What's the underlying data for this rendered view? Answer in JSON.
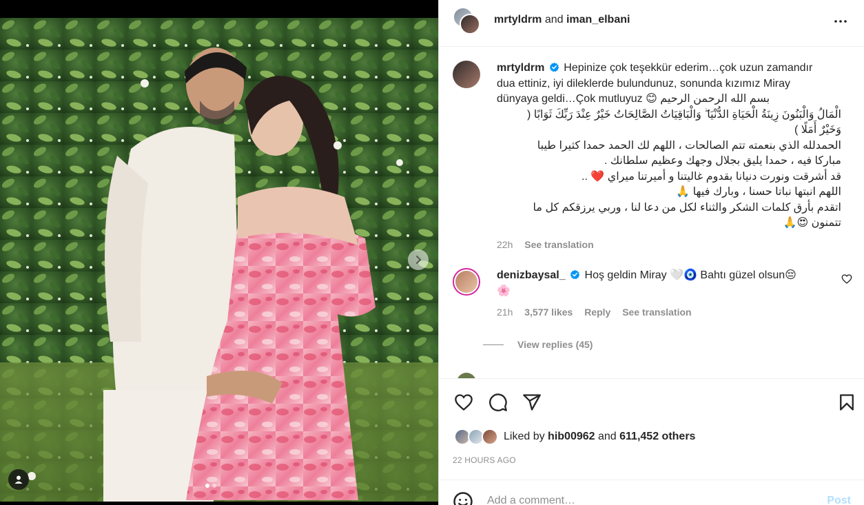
{
  "post": {
    "header": {
      "author": "mrtyldrm",
      "and": "and",
      "coauthor": "iman_elbani"
    },
    "caption": {
      "username": "mrtyldrm",
      "text_lines": [
        "Hepinize çok teşekkür ederim…çok uzun zamandır",
        "dua ettiniz, iyi dileklerde bulundunuz, sonunda kızımız Miray",
        "dünyaya geldi…Çok mutluyuz 😊 بسم الله الرحمن الرحيم"
      ],
      "arabic_lines": [
        "الْمَالُ وَالْبَنُونَ زِينَةُ الْحَيَاةِ الدُّنْيَا ۖ وَالْبَاقِيَاتُ الصَّالِحَاتُ خَيْرٌ عِنْدَ رَبِّكَ ثَوَابًا (",
        "وَخَيْرٌ أَمَلًا )",
        "الحمدلله الذي بنعمته تتم الصالحات ، اللهم لك الحمد حمدا كثيرا طيبا",
        "مباركا فيه ، حمدا يليق بجلال وجهك وعظيم سلطانك .",
        "قد أشرقت ونورت دنيانا بقدوم غاليتنا و أميرتنا ميراي ❤️ ..",
        "اللهم انبتها نباتا حسنا ، وبارك فيها 🙏",
        "اتقدم بأرق كلمات الشكر والثناء لكل من دعا لنا ، وربي يرزقكم كل ما",
        "تتمنون 😍🙏"
      ],
      "time": "22h",
      "see_translation": "See translation"
    },
    "comment": {
      "username": "denizbaysal_",
      "text": "Hoş geldin Miray 🤍🧿 Bahtı güzel olsun😔",
      "text_line2": "🌸",
      "time": "21h",
      "likes": "3,577 likes",
      "reply": "Reply",
      "see_translation": "See translation",
      "view_replies": "View replies (45)"
    },
    "likes": {
      "prefix": "Liked by",
      "user": "hib00962",
      "middle": "and",
      "count": "611,452 others"
    },
    "timestamp": "22 HOURS AGO",
    "add_comment": {
      "placeholder": "Add a comment…",
      "post_label": "Post"
    },
    "carousel": {
      "current": 1,
      "total": 2
    }
  },
  "colors": {
    "verified": "#0095f6",
    "muted": "#8e8e8e",
    "post_disabled": "#b2dffc",
    "dress_pink": "#f08fa6",
    "shirt_white": "#f1ece4"
  },
  "icons": [
    "more-icon",
    "verified-icon",
    "heart-icon",
    "comment-icon",
    "share-icon",
    "bookmark-icon",
    "chevron-right-icon",
    "user-tag-icon",
    "emoji-icon"
  ]
}
